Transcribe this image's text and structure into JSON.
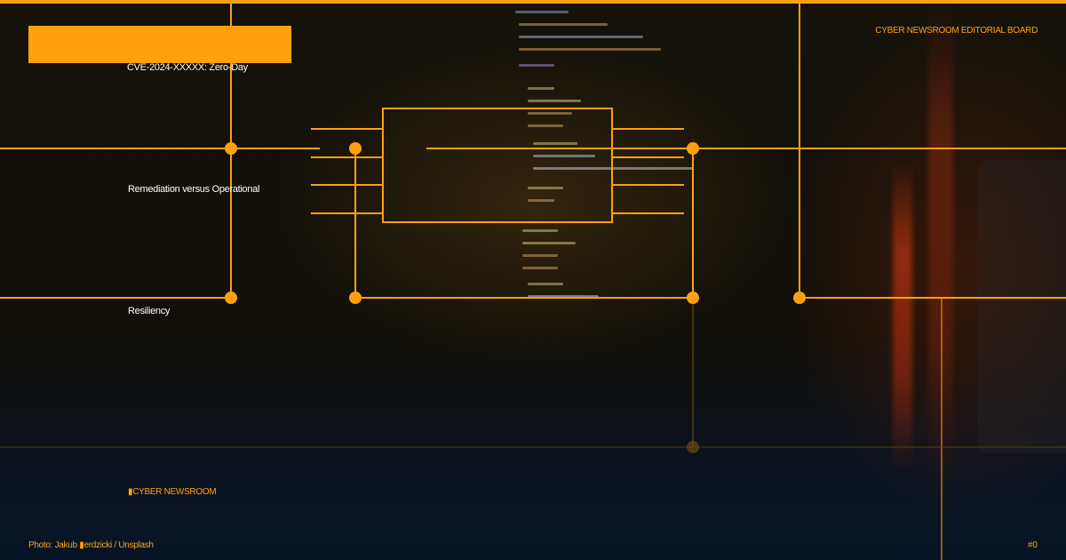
{
  "header": {
    "board": "CYBER NEWSROOM EDITORIAL BOARD"
  },
  "main": {
    "headline": "CVE-2024-XXXXX: Zero-Day",
    "topic_2": "Remediation versus Operational",
    "topic_3": "Resiliency"
  },
  "footer": {
    "brand": "▮CYBER NEWSROOM",
    "credit": "Photo: Jakub ▮erdzicki / Unsplash",
    "page_number": "#0"
  },
  "colors": {
    "accent": "#ffa10e",
    "text": "#ffffff",
    "background": "#110f09"
  }
}
